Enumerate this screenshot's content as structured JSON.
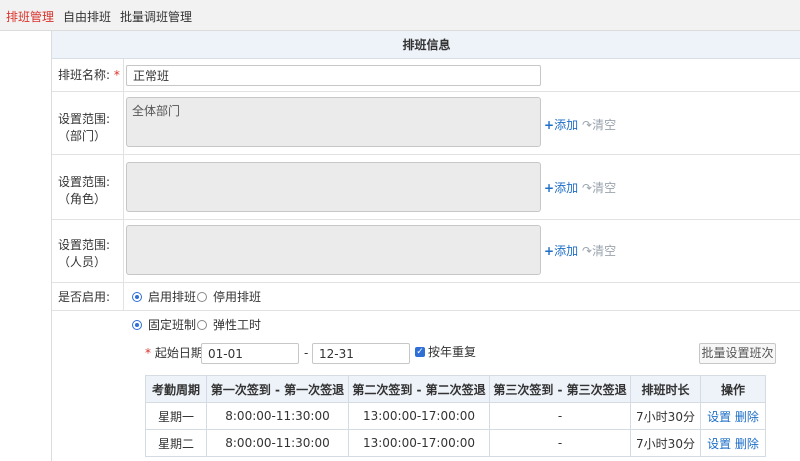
{
  "tabs": [
    {
      "label": "排班管理",
      "active": true
    },
    {
      "label": "自由排班",
      "active": false
    },
    {
      "label": "批量调班管理",
      "active": false
    }
  ],
  "section_title": "排班信息",
  "name_field": {
    "label": "排班名称:",
    "required_mark": "*",
    "value": "正常班"
  },
  "scopes": [
    {
      "label_line1": "设置范围:",
      "label_line2": "（部门）",
      "content": "全体部门",
      "add_label": "添加",
      "clear_label": "清空"
    },
    {
      "label_line1": "设置范围:",
      "label_line2": "（角色）",
      "content": "",
      "add_label": "添加",
      "clear_label": "清空"
    },
    {
      "label_line1": "设置范围:",
      "label_line2": "（人员）",
      "content": "",
      "add_label": "添加",
      "clear_label": "清空"
    }
  ],
  "enabled": {
    "label": "是否启用:",
    "on_label": "启用排班",
    "off_label": "停用排班",
    "selected": "on"
  },
  "mode": {
    "fixed_label": "固定班制",
    "flex_label": "弹性工时",
    "selected": "fixed"
  },
  "date_range": {
    "required_mark": "*",
    "label": "起始日期:",
    "start": "01-01",
    "separator": "-",
    "end": "12-31",
    "repeat_label": "按年重复",
    "repeat_checked": true
  },
  "batch_button": "批量设置班次",
  "table": {
    "headers": [
      "考勤周期",
      "第一次签到 - 第一次签退",
      "第二次签到 - 第二次签退",
      "第三次签到 - 第三次签退",
      "排班时长",
      "操作"
    ],
    "rows": [
      {
        "day": "星期一",
        "s1": "8:00:00-11:30:00",
        "s2": "13:00:00-17:00:00",
        "s3": "-",
        "duration": "7小时30分",
        "edit": "设置",
        "delete": "删除"
      },
      {
        "day": "星期二",
        "s1": "8:00:00-11:30:00",
        "s2": "13:00:00-17:00:00",
        "s3": "-",
        "duration": "7小时30分",
        "edit": "设置",
        "delete": "删除"
      }
    ]
  },
  "colors": {
    "accent": "#d9322b",
    "link": "#1e6ec8",
    "header_bg": "#eef3f9"
  },
  "icons": {
    "add": "plus-icon",
    "clear": "refresh-arrow-icon",
    "checkbox": "checkmark-icon"
  }
}
